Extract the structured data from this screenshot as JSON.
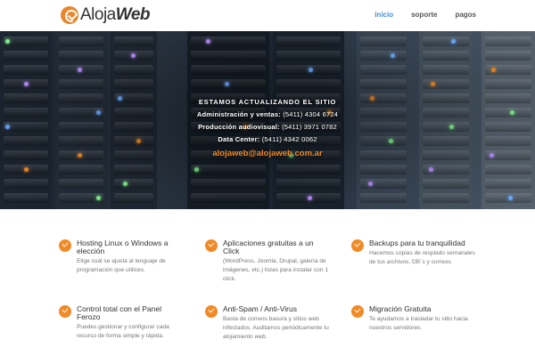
{
  "brand": {
    "name_regular": "Aloja",
    "name_bold": "Web"
  },
  "nav": [
    {
      "label": "inicio",
      "active": true
    },
    {
      "label": "soporte",
      "active": false
    },
    {
      "label": "pagos",
      "active": false
    }
  ],
  "hero": {
    "title": "ESTAMOS ACTUALIZANDO EL SITIO",
    "contacts": [
      {
        "label": "Administración y ventas:",
        "value": "(5411) 4304 6724"
      },
      {
        "label": "Producción audiovisual:",
        "value": "(5411) 3971 0782"
      },
      {
        "label": "Data Center:",
        "value": "(5411) 4342 0062"
      }
    ],
    "email": "alojaweb@alojaweb.com.ar"
  },
  "features": [
    {
      "title": "Hosting Linux o Windows a elección",
      "desc": "Elige cuál se ajusta al lenguaje de programación que utilices."
    },
    {
      "title": "Aplicaciones gratuitas a un Click",
      "desc": "(WordPress, Joomla, Drupal, galería de imágenes, etc.) listas para instalar con 1 click."
    },
    {
      "title": "Backups para tu tranquilidad",
      "desc": "Hacemos copias de resplado semanales de tus archivos, DB´s y correos."
    },
    {
      "title": "Control total con el Panel Ferozo",
      "desc": "Puedes gestionar y configurar cada recurso de forma simple y rápida."
    },
    {
      "title": "Anti-Spam / Anti-Virus",
      "desc": "Basta de correos basura y sitios web infectados. Auditamos periódicamente tu",
      "desc_em": "alojamiento web",
      "desc_end": "."
    },
    {
      "title": "Migración Gratuita",
      "desc": "Te ayudamos a trasladar tu sitio hacia nuestros servidores."
    }
  ],
  "colors": {
    "accent": "#f08a26",
    "nav_active": "#3b8fd6",
    "text": "#333333",
    "muted": "#777777"
  },
  "icons": {
    "feature": "checkmark-circle-icon",
    "logo": "alojaweb-logo-icon"
  }
}
